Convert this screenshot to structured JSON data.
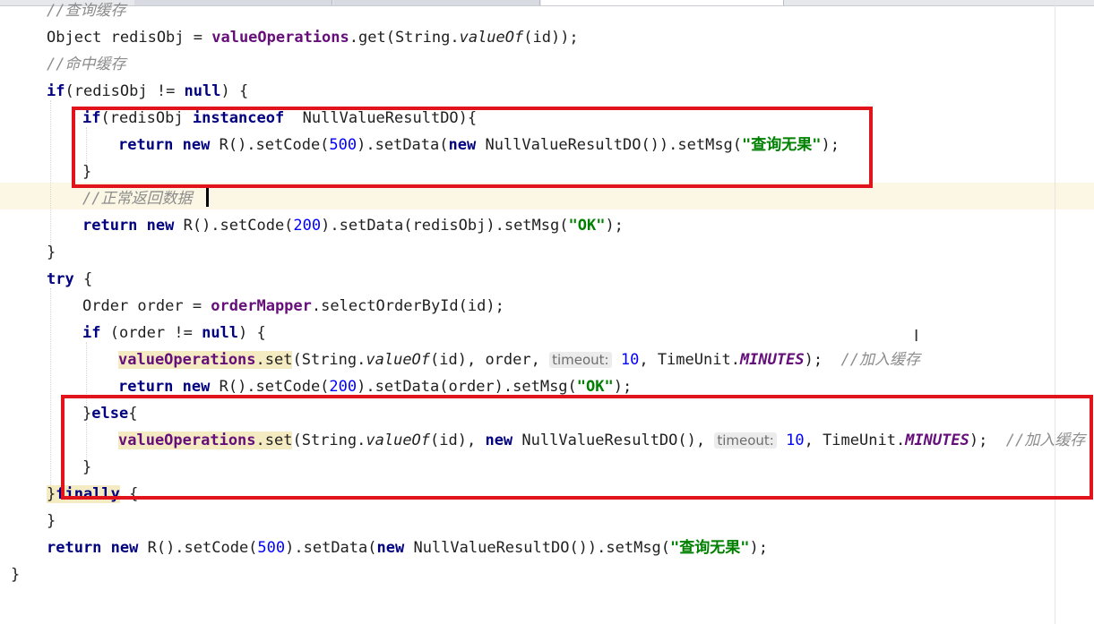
{
  "editor": {
    "lines": [
      {
        "indent": 1,
        "tokens": [
          {
            "t": "//查询缓存",
            "c": "cmt"
          }
        ]
      },
      {
        "indent": 1,
        "tokens": [
          {
            "t": "Object redisObj = "
          },
          {
            "t": "valueOperations",
            "c": "field"
          },
          {
            "t": ".get(String."
          },
          {
            "t": "valueOf",
            "c": "static"
          },
          {
            "t": "(id));"
          }
        ]
      },
      {
        "indent": 1,
        "tokens": [
          {
            "t": "//命中缓存",
            "c": "cmt"
          }
        ]
      },
      {
        "indent": 1,
        "tokens": [
          {
            "t": "if",
            "c": "kw"
          },
          {
            "t": "(redisObj != "
          },
          {
            "t": "null",
            "c": "kw"
          },
          {
            "t": ") {"
          }
        ]
      },
      {
        "indent": 2,
        "tokens": [
          {
            "t": "if",
            "c": "kw"
          },
          {
            "t": "(redisObj "
          },
          {
            "t": "instanceof",
            "c": "kw"
          },
          {
            "t": "  NullValueResultDO){"
          }
        ]
      },
      {
        "indent": 3,
        "tokens": [
          {
            "t": "return new",
            "c": "kw"
          },
          {
            "t": " R().setCode("
          },
          {
            "t": "500",
            "c": "num"
          },
          {
            "t": ").setData("
          },
          {
            "t": "new",
            "c": "kw"
          },
          {
            "t": " NullValueResultDO()).setMsg("
          },
          {
            "t": "\"查询无果\"",
            "c": "str"
          },
          {
            "t": ");"
          }
        ]
      },
      {
        "indent": 2,
        "tokens": [
          {
            "t": "}"
          }
        ]
      },
      {
        "indent": 2,
        "tokens": [
          {
            "t": "//正常返回数据",
            "c": "cmt"
          }
        ]
      },
      {
        "indent": 2,
        "tokens": [
          {
            "t": "return new",
            "c": "kw"
          },
          {
            "t": " R().setCode("
          },
          {
            "t": "200",
            "c": "num"
          },
          {
            "t": ").setData(redisObj).setMsg("
          },
          {
            "t": "\"OK\"",
            "c": "str"
          },
          {
            "t": ");"
          }
        ]
      },
      {
        "indent": 1,
        "tokens": [
          {
            "t": "}"
          }
        ]
      },
      {
        "indent": 1,
        "tokens": [
          {
            "t": "try",
            "c": "kw"
          },
          {
            "t": " {"
          }
        ]
      },
      {
        "indent": 2,
        "tokens": [
          {
            "t": "Order order = "
          },
          {
            "t": "orderMapper",
            "c": "field"
          },
          {
            "t": ".selectOrderById(id);"
          }
        ]
      },
      {
        "indent": 2,
        "tokens": [
          {
            "t": "if",
            "c": "kw"
          },
          {
            "t": " (order != "
          },
          {
            "t": "null",
            "c": "kw"
          },
          {
            "t": ") {"
          }
        ]
      },
      {
        "indent": 3,
        "tokens": [
          {
            "t": "valueOperations",
            "c": "field hl"
          },
          {
            "t": ".set",
            "c": "hl"
          },
          {
            "t": "(String."
          },
          {
            "t": "valueOf",
            "c": "static"
          },
          {
            "t": "(id), order, "
          },
          {
            "t": "timeout:",
            "c": "hint"
          },
          {
            "t": " "
          },
          {
            "t": "10",
            "c": "num"
          },
          {
            "t": ", TimeUnit."
          },
          {
            "t": "MINUTES",
            "c": "const"
          },
          {
            "t": ");  "
          },
          {
            "t": "//加入缓存",
            "c": "cmt"
          }
        ]
      },
      {
        "indent": 3,
        "tokens": [
          {
            "t": "return new",
            "c": "kw"
          },
          {
            "t": " R().setCode("
          },
          {
            "t": "200",
            "c": "num"
          },
          {
            "t": ").setData(order).setMsg("
          },
          {
            "t": "\"OK\"",
            "c": "str"
          },
          {
            "t": ");"
          }
        ]
      },
      {
        "indent": 2,
        "tokens": [
          {
            "t": "}"
          },
          {
            "t": "else",
            "c": "kw"
          },
          {
            "t": "{"
          }
        ]
      },
      {
        "indent": 3,
        "tokens": [
          {
            "t": "valueOperations",
            "c": "field hl"
          },
          {
            "t": ".set",
            "c": "hl"
          },
          {
            "t": "(String."
          },
          {
            "t": "valueOf",
            "c": "static"
          },
          {
            "t": "(id), "
          },
          {
            "t": "new",
            "c": "kw"
          },
          {
            "t": " NullValueResultDO(), "
          },
          {
            "t": "timeout:",
            "c": "hint"
          },
          {
            "t": " "
          },
          {
            "t": "10",
            "c": "num"
          },
          {
            "t": ", TimeUnit."
          },
          {
            "t": "MINUTES",
            "c": "const"
          },
          {
            "t": ");  "
          },
          {
            "t": "//加入缓存",
            "c": "cmt"
          }
        ]
      },
      {
        "indent": 2,
        "tokens": [
          {
            "t": "}"
          }
        ]
      },
      {
        "indent": 1,
        "tokens": [
          {
            "t": "}",
            "c": "hl"
          },
          {
            "t": "finally",
            "c": "kw hl"
          },
          {
            "t": " {"
          }
        ]
      },
      {
        "indent": 1,
        "tokens": [
          {
            "t": "}"
          }
        ]
      },
      {
        "indent": 1,
        "tokens": [
          {
            "t": "return new",
            "c": "kw"
          },
          {
            "t": " R().setCode("
          },
          {
            "t": "500",
            "c": "num"
          },
          {
            "t": ").setData("
          },
          {
            "t": "new",
            "c": "kw"
          },
          {
            "t": " NullValueResultDO()).setMsg("
          },
          {
            "t": "\"查询无果\"",
            "c": "str"
          },
          {
            "t": ");"
          }
        ]
      },
      {
        "indent": 0,
        "tokens": [
          {
            "t": "}"
          }
        ]
      }
    ]
  },
  "colors": {
    "keyword": "#000080",
    "field": "#660e7a",
    "number": "#0000ff",
    "string": "#008000",
    "comment": "#8c8c8c",
    "annotation_box": "#e2141b",
    "current_line": "#fbf7e4"
  },
  "icons": [
    "text-cursor-icon"
  ]
}
